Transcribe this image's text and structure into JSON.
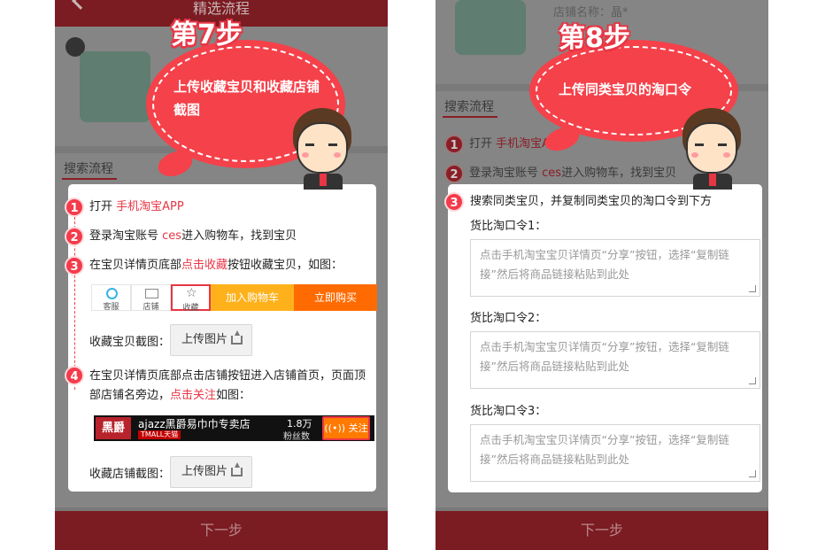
{
  "left_panel": {
    "header_title": "精选流程",
    "bg_tab": "搜索流程",
    "footer_next": "下一步",
    "step_title": "第7步",
    "bubble_text": "上传收藏宝贝和收藏店铺截图",
    "steps": [
      {
        "num": "1",
        "text": "打开 ",
        "highlight": "手机淘宝APP"
      },
      {
        "num": "2",
        "text_a": "登录淘宝账号 ",
        "highlight": "ces",
        "text_b": "进入购物车，找到宝贝"
      },
      {
        "num": "3",
        "text_a": "在宝贝详情页底部",
        "highlight": "点击收藏",
        "text_b": "按钮收藏宝贝，如图："
      },
      {
        "num": "4",
        "text_a": "在宝贝详情页底部点击店铺按钮进入店铺首页，页面顶部店铺名旁边，",
        "highlight": "点击关注",
        "text_b": "如图："
      }
    ],
    "shop_bar": {
      "service": "客服",
      "store": "店铺",
      "favorite": "收藏",
      "add_cart": "加入购物车",
      "buy_now": "立即购买"
    },
    "store_bar": {
      "logo": "黑爵",
      "name": "ajazz黑爵易巾巾专卖店",
      "tmall": "TMALL天猫",
      "fans_count": "1.8万",
      "fans_label": "粉丝数",
      "follow": "关注"
    },
    "fav_label": "收藏宝贝截图：",
    "shop_label": "收藏店铺截图：",
    "upload_label": "上传图片"
  },
  "right_panel": {
    "bg_shop_name": "店铺名称：晶*",
    "bg_tab": "搜索流程",
    "footer_next": "下一步",
    "step_title": "第8步",
    "bubble_text": "上传同类宝贝的淘口令",
    "steps": [
      {
        "num": "1",
        "text": "打开 ",
        "highlight": "手机淘宝APP"
      },
      {
        "num": "2",
        "text_a": "登录淘宝账号 ",
        "highlight": "ces",
        "text_b": "进入购物车，找到宝贝"
      },
      {
        "num": "3",
        "text": "搜索同类宝贝，并复制同类宝贝的淘口令到下方"
      }
    ],
    "fields": [
      {
        "label": "货比淘口令1：",
        "placeholder": "点击手机淘宝宝贝详情页“分享”按钮，选择“复制链接”然后将商品链接粘贴到此处"
      },
      {
        "label": "货比淘口令2：",
        "placeholder": "点击手机淘宝宝贝详情页“分享”按钮，选择“复制链接”然后将商品链接粘贴到此处"
      },
      {
        "label": "货比淘口令3：",
        "placeholder": "点击手机淘宝宝贝详情页“分享”按钮，选择“复制链接”然后将商品链接粘贴到此处"
      }
    ]
  },
  "colors": {
    "accent": "#f43b4b",
    "highlight_text": "#e83645",
    "cart": "#ffb11b",
    "buy": "#ff6b00"
  }
}
